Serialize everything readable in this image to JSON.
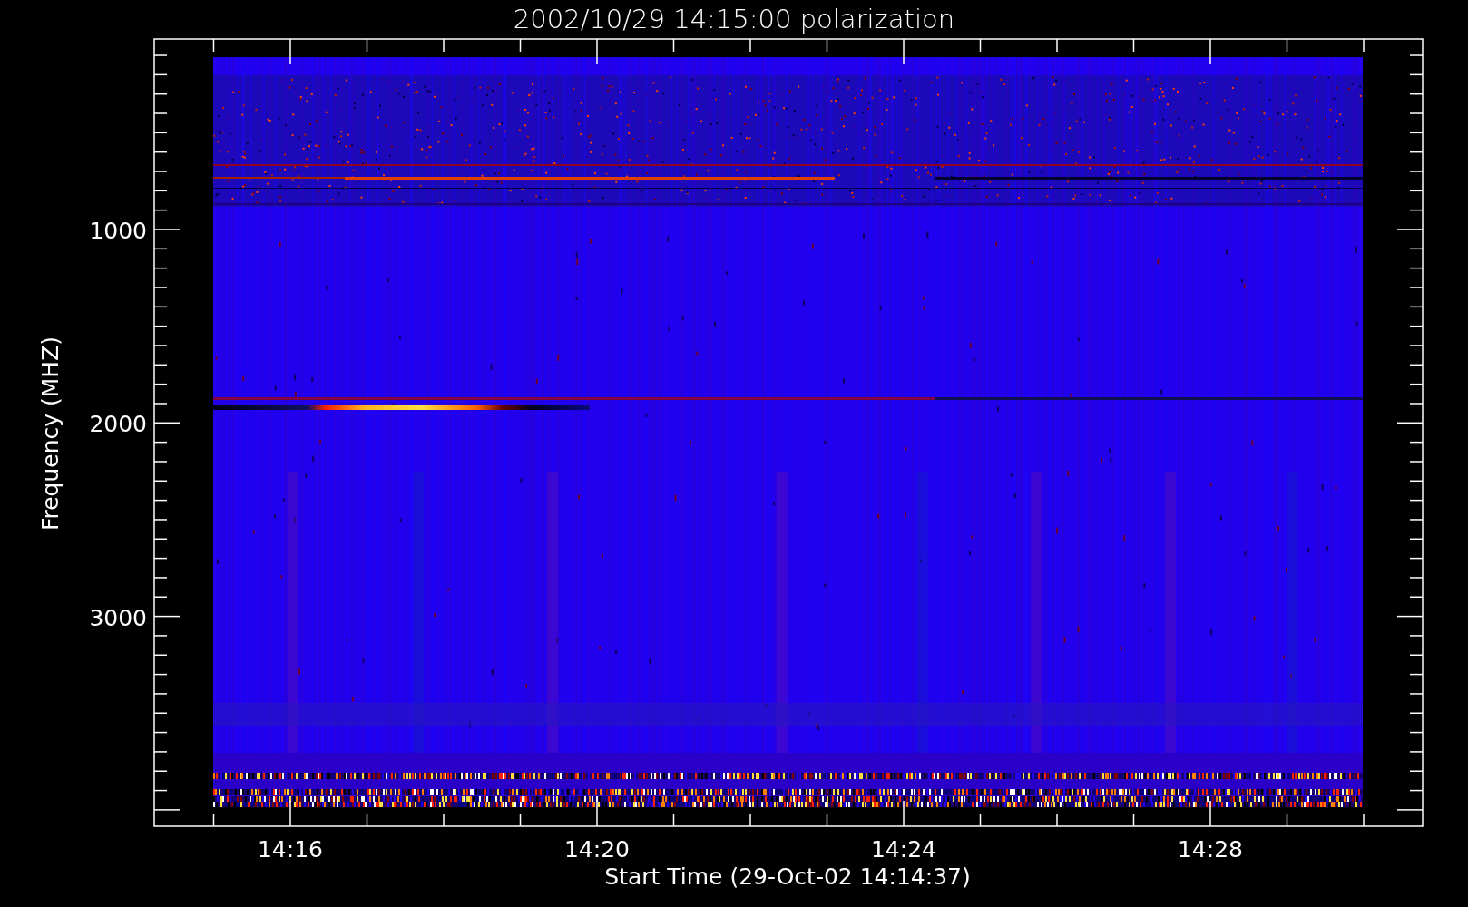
{
  "title": "2002/10/29 14:15:00 polarization",
  "y_axis": {
    "title": "Frequency (MHZ)",
    "ticks": [
      {
        "label": "1000"
      },
      {
        "label": "2000"
      },
      {
        "label": "3000"
      }
    ]
  },
  "x_axis": {
    "title": "Start Time (29-Oct-02 14:14:37)",
    "ticks": [
      {
        "label": "14:16"
      },
      {
        "label": "14:20"
      },
      {
        "label": "14:24"
      },
      {
        "label": "14:28"
      }
    ]
  }
}
